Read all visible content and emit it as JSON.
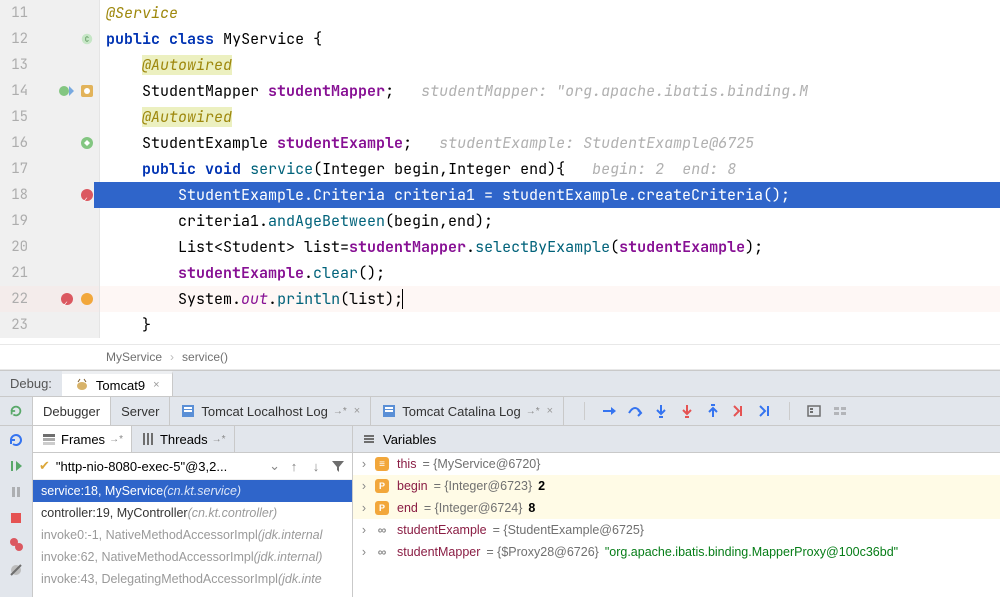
{
  "code": {
    "lines": [
      {
        "n": 11
      },
      {
        "n": 12
      },
      {
        "n": 13
      },
      {
        "n": 14
      },
      {
        "n": 15
      },
      {
        "n": 16
      },
      {
        "n": 17
      },
      {
        "n": 18
      },
      {
        "n": 19
      },
      {
        "n": 20
      },
      {
        "n": 21
      },
      {
        "n": 22
      },
      {
        "n": 23
      }
    ],
    "l11_anno": "@Service",
    "l12_kw1": "public",
    "l12_kw2": "class",
    "l12_name": "MyService",
    "l13_anno": "@Autowired",
    "l14_type": "StudentMapper",
    "l14_field": "studentMapper",
    "l14_hint_lbl": "studentMapper:",
    "l14_hint_val": "\"org.apache.ibatis.binding.M",
    "l15_anno": "@Autowired",
    "l16_type": "StudentExample",
    "l16_field": "studentExample",
    "l16_hint_lbl": "studentExample:",
    "l16_hint_val": "StudentExample@6725",
    "l17_kw1": "public",
    "l17_kw2": "void",
    "l17_name": "service",
    "l17_sig": "(Integer begin,Integer end)",
    "l17_hint_b": "begin:",
    "l17_hint_bv": "2",
    "l17_hint_e": "end:",
    "l17_hint_ev": "8",
    "l18_text": "        StudentExample.Criteria criteria1 = studentExample.createCriteria();",
    "l19_a": "criteria1.",
    "l19_m": "andAgeBetween",
    "l19_b": "(begin,end);",
    "l20_a": "List<Student> list=",
    "l20_f": "studentMapper",
    "l20_b": ".",
    "l20_m": "selectByExample",
    "l20_c": "(",
    "l20_f2": "studentExample",
    "l20_d": ");",
    "l21_f": "studentExample",
    "l21_m": "clear",
    "l22_a": "System.",
    "l22_o": "out",
    "l22_b": ".",
    "l22_m": "println",
    "l22_c": "(list);"
  },
  "breadcrumb": {
    "a": "MyService",
    "b": "service()"
  },
  "debug": {
    "label": "Debug:",
    "runconfig": "Tomcat9",
    "tabs": {
      "debugger": "Debugger",
      "server": "Server",
      "t3": "Tomcat Localhost Log",
      "t4": "Tomcat Catalina Log"
    },
    "frames_label": "Frames",
    "threads_label": "Threads",
    "variables_label": "Variables",
    "thread": "\"http-nio-8080-exec-5\"@3,2...",
    "frames": [
      {
        "m": "service:18, MyService ",
        "p": "(cn.kt.service)",
        "sel": true
      },
      {
        "m": "controller:19, MyController ",
        "p": "(cn.kt.controller)"
      },
      {
        "m": "invoke0:-1, NativeMethodAccessorImpl ",
        "p": "(jdk.internal",
        "dim": true
      },
      {
        "m": "invoke:62, NativeMethodAccessorImpl ",
        "p": "(jdk.internal)",
        "dim": true
      },
      {
        "m": "invoke:43, DelegatingMethodAccessorImpl ",
        "p": "(jdk.inte",
        "dim": true
      }
    ],
    "vars": [
      {
        "ic": "eq",
        "n": "this",
        "v": " = {MyService@6720}"
      },
      {
        "ic": "p",
        "n": "begin",
        "v": " = {Integer@6723} ",
        "b": "2",
        "hl": true
      },
      {
        "ic": "p",
        "n": "end",
        "v": " = {Integer@6724} ",
        "b": "8",
        "hl": true
      },
      {
        "ic": "link",
        "n": "studentExample",
        "v": " = {StudentExample@6725}"
      },
      {
        "ic": "link",
        "n": "studentMapper",
        "v": " = {$Proxy28@6726} ",
        "s": "\"org.apache.ibatis.binding.MapperProxy@100c36bd\""
      }
    ]
  }
}
